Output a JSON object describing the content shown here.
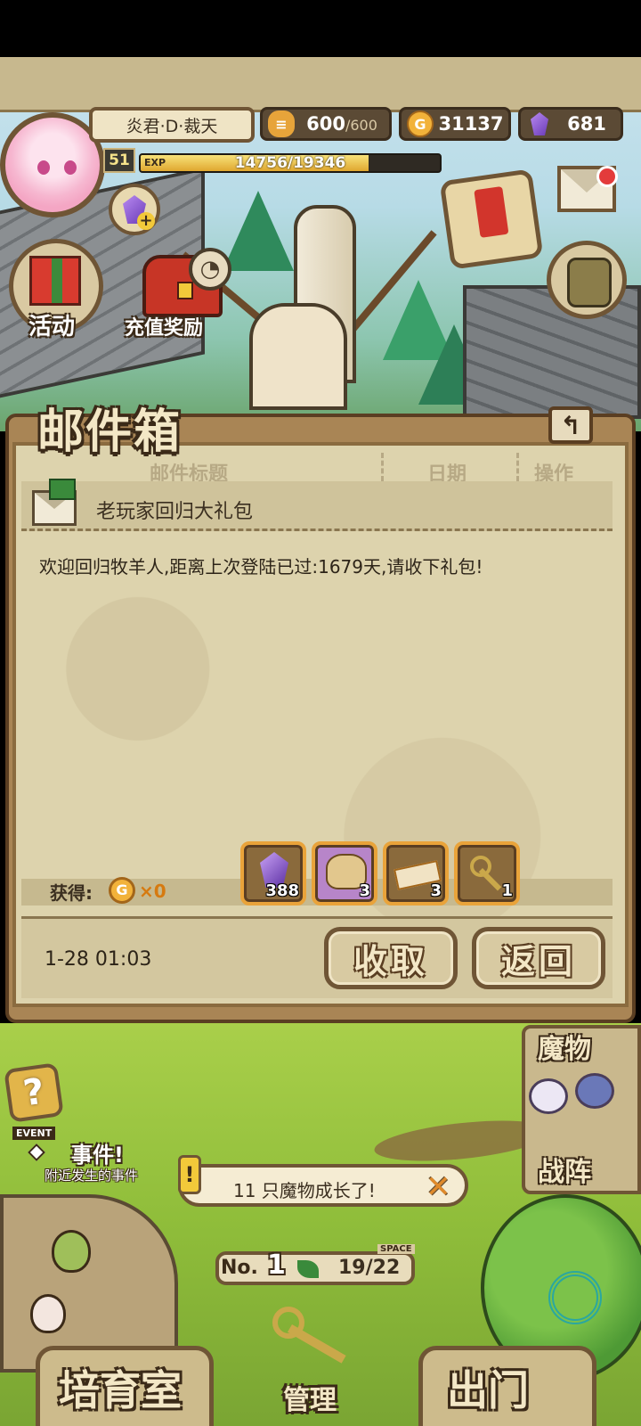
{
  "player": {
    "name": "炎君·D·裁天",
    "level": "51",
    "exp_label": "EXP",
    "exp_text": "14756/19346",
    "exp_fraction": 0.7628
  },
  "resources": {
    "stamina_current": "600",
    "stamina_max": "/600",
    "gold": "31137",
    "gems": "681"
  },
  "hud": {
    "activity_label": "活动",
    "recharge_label": "充值奖励"
  },
  "mailbox": {
    "title": "邮件箱",
    "columns": [
      "邮件标题",
      "日期",
      "操作"
    ],
    "subject": "老玩家回归大礼包",
    "body": "欢迎回归牧羊人,距离上次登陆已过:1679天,请收下礼包!",
    "reward_label": "获得:",
    "gold_reward": "×0",
    "rewards": [
      {
        "icon": "purple-gem-icon",
        "count": "388"
      },
      {
        "icon": "treasure-bag-icon",
        "count": "3"
      },
      {
        "icon": "ticket-icon",
        "count": "3"
      },
      {
        "icon": "golden-key-icon",
        "count": "1"
      }
    ],
    "date": "1-28 01:03",
    "collect_label": "收取",
    "back_label": "返回"
  },
  "field": {
    "event_tag": "EVENT",
    "event_title": "事件!",
    "event_sub": "附近发生的事件",
    "monster_label": "魔物",
    "formation_label": "战阵",
    "notice_text": "11 只魔物成长了!",
    "farm_no_label": "No.",
    "farm_no": "1",
    "capacity": "19/22",
    "space_tag": "SPACE"
  },
  "nav": {
    "nursery": "培育室",
    "manage": "管理",
    "depart": "出门"
  },
  "colors": {
    "parchment": "#ddd3ad",
    "frame_brown": "#6f5535",
    "gold_text": "#d67a10",
    "mail_dot": "#e33b3b"
  }
}
